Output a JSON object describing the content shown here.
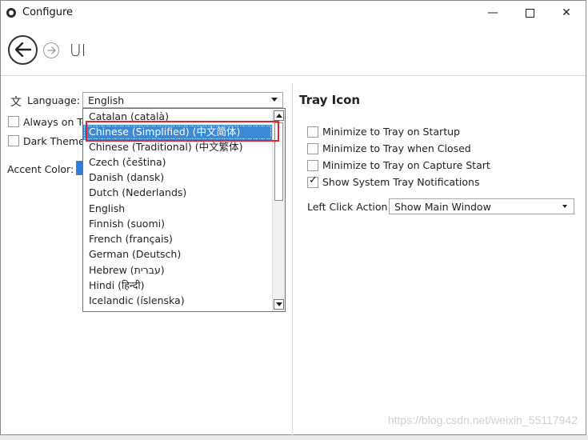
{
  "window": {
    "title": "Configure",
    "controls": {
      "minimize": "—",
      "close": "✕"
    }
  },
  "header": {
    "page_title": "UI"
  },
  "left": {
    "language_label": "Language:",
    "language_value": "English",
    "always_on_top": "Always on To",
    "dark_theme": "Dark Theme",
    "accent_label": "Accent Color:",
    "accent_color": "#2b7de0"
  },
  "dropdown": {
    "items": [
      "Catalan (català)",
      "Chinese (Simplified) (中文简体)",
      "Chinese (Traditional) (中文繁体)",
      "Czech (čeština)",
      "Danish (dansk)",
      "Dutch (Nederlands)",
      "English",
      "Finnish (suomi)",
      "French (français)",
      "German (Deutsch)",
      "Hebrew (עברית)",
      "Hindi (हिन्दी)",
      "Icelandic (íslenska)"
    ],
    "selected_index": 1
  },
  "tray": {
    "heading": "Tray Icon",
    "options": [
      {
        "label": "Minimize to Tray on Startup",
        "checked": false
      },
      {
        "label": "Minimize to Tray when Closed",
        "checked": false
      },
      {
        "label": "Minimize to Tray on Capture Start",
        "checked": false
      },
      {
        "label": "Show System Tray Notifications",
        "checked": true
      }
    ],
    "left_click_label": "Left Click Action",
    "left_click_value": "Show Main Window"
  },
  "watermark": "https://blog.csdn.net/weixin_55117942"
}
